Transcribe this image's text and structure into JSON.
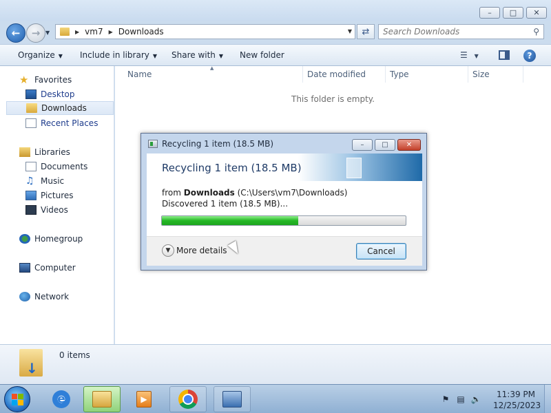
{
  "explorer": {
    "address": {
      "crumbs": [
        "vm7",
        "Downloads"
      ]
    },
    "search": {
      "placeholder": "Search Downloads"
    },
    "toolbar": {
      "organize": "Organize",
      "include_in_library": "Include in library",
      "share_with": "Share with",
      "new_folder": "New folder"
    },
    "nav": {
      "favorites": "Favorites",
      "desktop": "Desktop",
      "downloads": "Downloads",
      "recent_places": "Recent Places",
      "libraries": "Libraries",
      "documents": "Documents",
      "music": "Music",
      "pictures": "Pictures",
      "videos": "Videos",
      "homegroup": "Homegroup",
      "computer": "Computer",
      "network": "Network"
    },
    "columns": [
      "Name",
      "Date modified",
      "Type",
      "Size"
    ],
    "empty_message": "This folder is empty.",
    "details": {
      "items": "0 items"
    }
  },
  "dialog": {
    "title": "Recycling 1 item (18.5 MB)",
    "header": "Recycling 1 item (18.5 MB)",
    "from_prefix": "from",
    "from_folder": "Downloads",
    "from_path": "(C:\\Users\\vm7\\Downloads)",
    "discovered": "Discovered 1 item (18.5 MB)...",
    "progress_fraction": 0.56,
    "more_details": "More details",
    "cancel": "Cancel"
  },
  "taskbar": {
    "apps": [
      "internet-explorer",
      "windows-explorer",
      "windows-media-player",
      "google-chrome",
      "control-panel"
    ],
    "clock": {
      "time": "11:39 PM",
      "date": "12/25/2023"
    }
  }
}
